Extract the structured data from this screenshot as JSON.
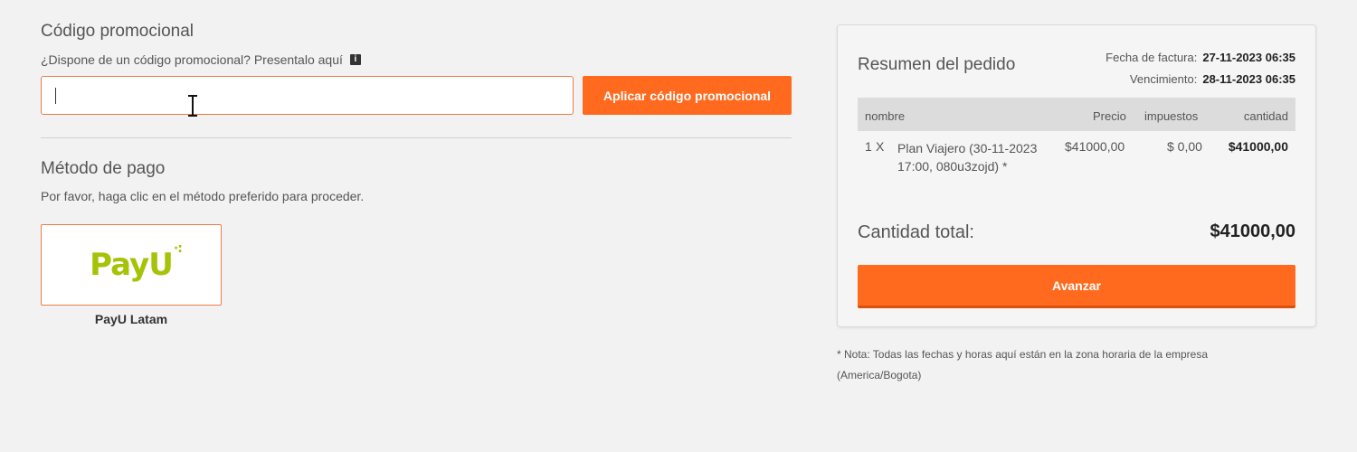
{
  "promo": {
    "heading": "Código promocional",
    "subtitle": "¿Dispone de un código promocional? Presentalo aquí",
    "info_icon": "i",
    "input_value": "",
    "apply_label": "Aplicar código promocional"
  },
  "payment": {
    "heading": "Método de pago",
    "subtitle": "Por favor, haga clic en el método preferido para proceder.",
    "method_logo_text": "PayU",
    "method_name": "PayU Latam"
  },
  "summary": {
    "title": "Resumen del pedido",
    "invoice_date_label": "Fecha de factura:",
    "invoice_date_value": "27-11-2023 06:35",
    "due_date_label": "Vencimiento:",
    "due_date_value": "28-11-2023 06:35",
    "columns": {
      "name": "nombre",
      "price": "Precio",
      "tax": "impuestos",
      "qty": "cantidad"
    },
    "items": [
      {
        "qty": "1",
        "x": "X",
        "description": "Plan Viajero (30-11-2023 17:00, 080u3zojd) *",
        "price": "$41000,00",
        "tax": "$ 0,00",
        "amount": "$41000,00"
      }
    ],
    "total_label": "Cantidad total:",
    "total_value": "$41000,00",
    "advance_label": "Avanzar"
  },
  "note": "* Nota: Todas las fechas y horas aquí están en la zona horaria de la empresa (America/Bogota)",
  "colors": {
    "accent": "#ff6a1f",
    "input_border": "#ef7b45",
    "payu_green": "#a6c307"
  }
}
